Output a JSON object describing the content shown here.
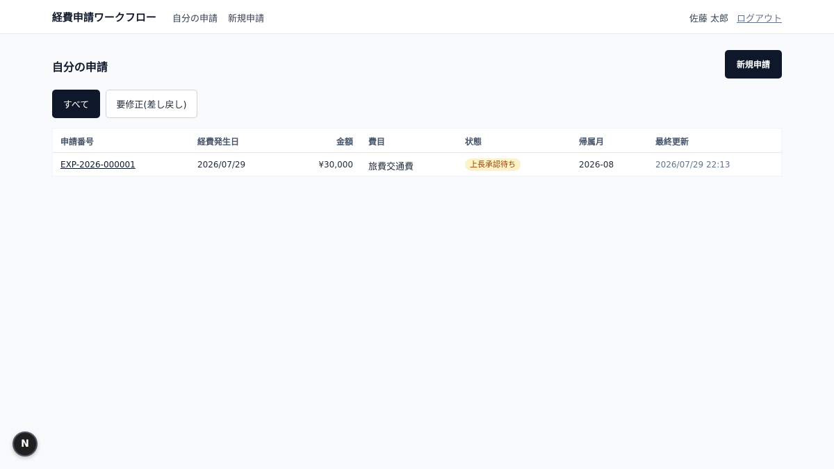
{
  "header": {
    "brand": "経費申請ワークフロー",
    "nav": [
      {
        "label": "自分の申請"
      },
      {
        "label": "新規申請"
      }
    ],
    "user_name": "佐藤 太郎",
    "logout_label": "ログアウト"
  },
  "main": {
    "title": "自分の申請",
    "new_button_label": "新規申請",
    "filters": [
      {
        "label": "すべて",
        "active": true
      },
      {
        "label": "要修正(差し戻し)",
        "active": false
      }
    ],
    "table": {
      "columns": [
        "申請番号",
        "経費発生日",
        "金額",
        "費目",
        "状態",
        "帰属月",
        "最終更新"
      ],
      "rows": [
        {
          "number": "EXP-2026-000001",
          "date": "2026/07/29",
          "amount": "¥30,000",
          "category": "旅費交通費",
          "status": "上長承認待ち",
          "month": "2026-08",
          "updated": "2026/07/29 22:13"
        }
      ]
    }
  },
  "dev_badge": {
    "label": "N"
  },
  "colors": {
    "primary": "#0f172a",
    "status_bg": "#fef3c7",
    "status_text": "#92400e",
    "background": "#f8fafc"
  }
}
